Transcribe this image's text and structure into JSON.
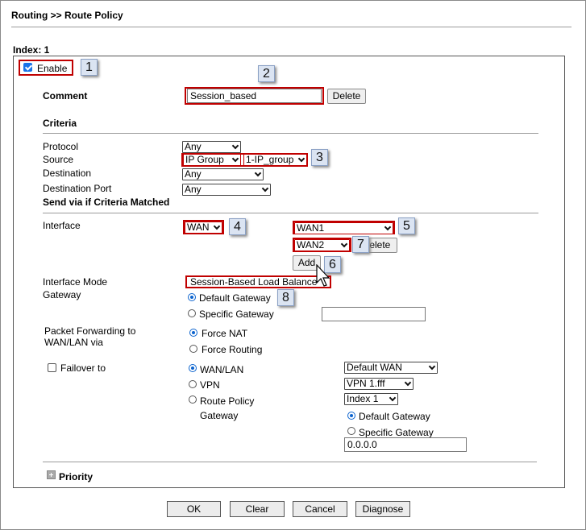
{
  "header": {
    "title": "Routing >> Route Policy"
  },
  "index_label": "Index: 1",
  "enable": {
    "label": "Enable",
    "checked": true
  },
  "comment": {
    "label": "Comment",
    "value": "Session_based",
    "delete_label": "Delete"
  },
  "criteria": {
    "heading": "Criteria",
    "protocol_label": "Protocol",
    "protocol_value": "Any",
    "source_label": "Source",
    "source_type": "IP Group",
    "source_group": "1-IP_group",
    "destination_label": "Destination",
    "destination_value": "Any",
    "dest_port_label": "Destination Port",
    "dest_port_value": "Any"
  },
  "send_via": {
    "heading": "Send via if Criteria Matched",
    "interface_label": "Interface",
    "interface_value": "WAN",
    "wan_first": "WAN1",
    "wan_second": "WAN2",
    "delete_label": "Delete",
    "add_label": "Add",
    "mode_label": "Interface Mode",
    "mode_value": "Session-Based Load Balance",
    "gateway_label": "Gateway",
    "default_gateway": "Default Gateway",
    "specific_gateway": "Specific Gateway",
    "gateway_choice": "default"
  },
  "forwarding": {
    "label_line1": "Packet Forwarding to",
    "label_line2": "WAN/LAN via",
    "force_nat": "Force NAT",
    "force_routing": "Force Routing",
    "choice": "nat"
  },
  "failover": {
    "label": "Failover to",
    "checked": false,
    "wan_lan": "WAN/LAN",
    "wan_lan_value": "Default WAN",
    "vpn": "VPN",
    "vpn_value": "VPN 1.fff",
    "route_policy": "Route Policy",
    "route_policy_value": "Index 1",
    "gateway_label": "Gateway",
    "default_gateway": "Default Gateway",
    "specific_gateway": "Specific Gateway",
    "gateway_ip": "0.0.0.0",
    "choice": "wan_lan",
    "gateway_choice": "default"
  },
  "priority": {
    "label": "Priority"
  },
  "buttons": {
    "ok": "OK",
    "clear": "Clear",
    "cancel": "Cancel",
    "diagnose": "Diagnose"
  },
  "callouts": [
    "1",
    "2",
    "3",
    "4",
    "5",
    "6",
    "7",
    "8"
  ],
  "colors": {
    "highlight": "#c00000",
    "radio_selected": "#0b63ce",
    "callout_bg": "#dbe4f2"
  }
}
